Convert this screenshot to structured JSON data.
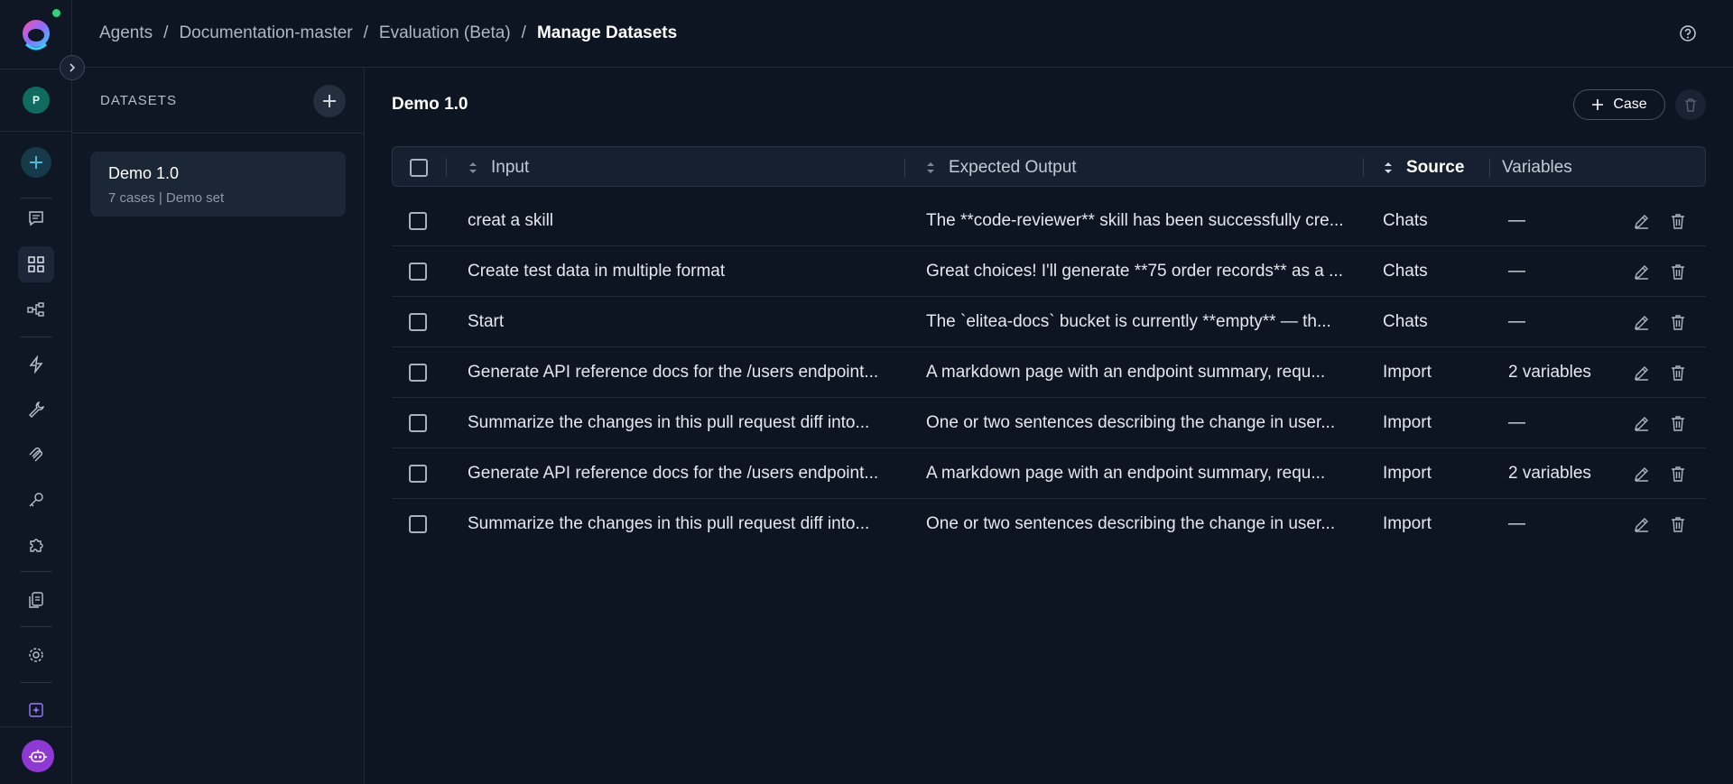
{
  "breadcrumb": [
    "Agents",
    "Documentation-master",
    "Evaluation (Beta)",
    "Manage Datasets"
  ],
  "sidebar": {
    "avatar_initial": "P"
  },
  "datasets": {
    "title": "DATASETS",
    "items": [
      {
        "name": "Demo 1.0",
        "meta": "7 cases | Demo set"
      }
    ]
  },
  "main": {
    "title": "Demo 1.0",
    "case_button": "Case"
  },
  "table": {
    "columns": {
      "input": "Input",
      "expected_output": "Expected Output",
      "source": "Source",
      "variables": "Variables"
    },
    "rows": [
      {
        "input": "creat a skill",
        "expected": "The **code-reviewer** skill has been successfully cre...",
        "source": "Chats",
        "variables": "—"
      },
      {
        "input": "Create test data in multiple format",
        "expected": "Great choices! I'll generate **75 order records** as a ...",
        "source": "Chats",
        "variables": "—"
      },
      {
        "input": "Start",
        "expected": "The `elitea-docs` bucket is currently **empty** — th...",
        "source": "Chats",
        "variables": "—"
      },
      {
        "input": "Generate API reference docs for the /users endpoint...",
        "expected": "A markdown page with an endpoint summary, requ...",
        "source": "Import",
        "variables": "2 variables"
      },
      {
        "input": "Summarize the changes in this pull request diff into...",
        "expected": "One or two sentences describing the change in user...",
        "source": "Import",
        "variables": "—"
      },
      {
        "input": "Generate API reference docs for the /users endpoint...",
        "expected": "A markdown page with an endpoint summary, requ...",
        "source": "Import",
        "variables": "2 variables"
      },
      {
        "input": "Summarize the changes in this pull request diff into...",
        "expected": "One or two sentences describing the change in user...",
        "source": "Import",
        "variables": "—"
      }
    ]
  },
  "colors": {
    "background": "#0e1522",
    "accent": "#4fb7d9",
    "bot": "#8e39d4",
    "online": "#2fd27c"
  }
}
